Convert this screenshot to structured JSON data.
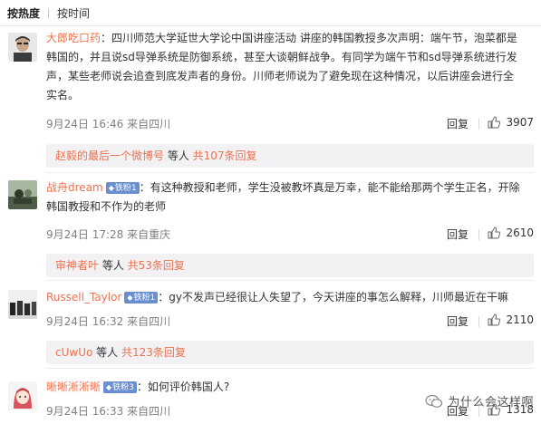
{
  "sort": {
    "hot": "按热度",
    "time": "按时间"
  },
  "comments": [
    {
      "user": "大郎吃口药",
      "lines": [
        "：四川师范大学延世大学论中国讲座活动 讲座的韩国教授多次声明：端午节，泡菜都是",
        "韩国的，并且说sd导弹系统是防御系统，甚至大谈朝鲜战争。有同学为端午节和sd导弹系统进行发",
        "声，某些老师说会追查到底发声者的身份。川师老师说为了避免现在这种情况，以后讲座会进行全",
        "实名。"
      ],
      "time": "9月24日 16:46 来自四川",
      "reply": "回复",
      "likes": "3907",
      "sub": {
        "name": "赵毅的最后一个微博号",
        "mid": " 等人 ",
        "total": "共107条回复"
      }
    },
    {
      "user": "战舟dream",
      "badge": "铁粉1",
      "lines": [
        "：有这种教授和老师，学生没被教坏真是万幸，能不能给那两个学生正名，开除",
        "韩国教授和不作为的老师"
      ],
      "time": "9月24日 17:28 来自重庆",
      "reply": "回复",
      "likes": "2610",
      "sub": {
        "name": "审神者叶",
        "mid": " 等人 ",
        "total": "共53条回复"
      }
    },
    {
      "user": "Russell_Taylor",
      "badge": "铁粉1",
      "lines": [
        "：gy不发声已经很让人失望了，今天讲座的事怎么解释，川师最近在干嘛"
      ],
      "time": "9月24日 16:32 来自四川",
      "reply": "回复",
      "likes": "2110",
      "sub": {
        "name": "cUwUo",
        "mid": " 等人 ",
        "total": "共123条回复"
      }
    },
    {
      "user": "晰晰淅淅晰",
      "badge": "铁粉3",
      "lines": [
        "：如何评价韩国人?"
      ],
      "time": "9月24日 16:33 来自四川",
      "reply": "回复",
      "likes": "1318"
    }
  ],
  "watermark": "为什么会这样啊",
  "colors": {
    "username": "#eb7350",
    "badge": "#6a8fd0",
    "subreply_bg": "#f2f2f5"
  }
}
